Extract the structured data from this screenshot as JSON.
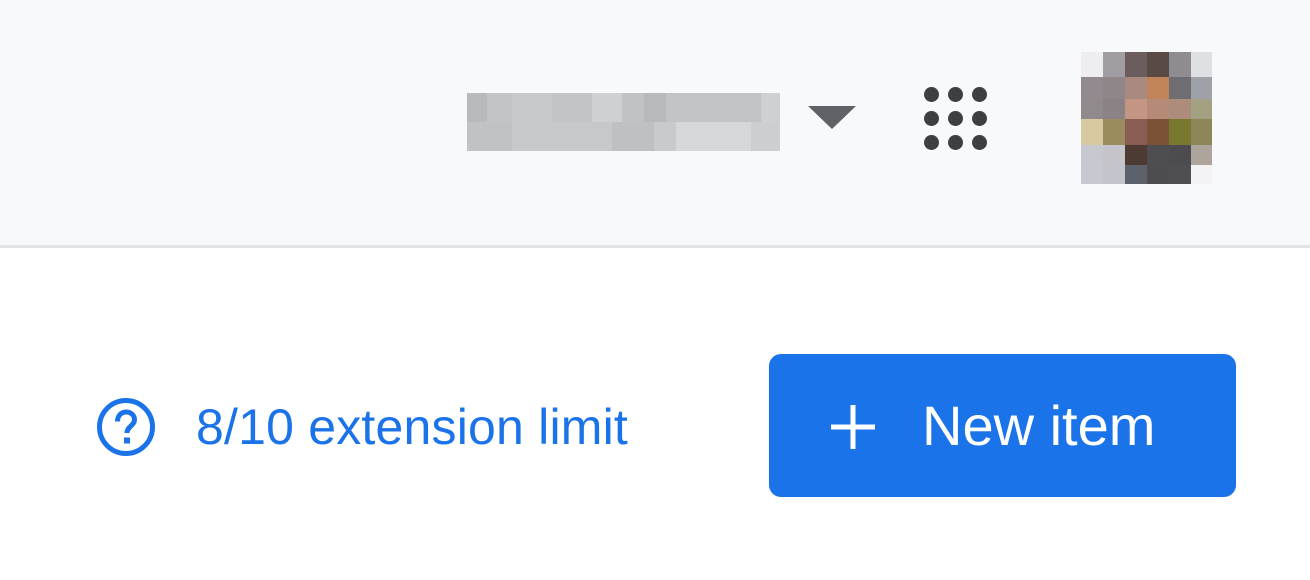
{
  "header": {
    "account_name_redacted": true,
    "dropdown_icon": "caret-down-icon",
    "apps_icon": "apps-grid-icon",
    "avatar_icon": "user-avatar"
  },
  "toolbar": {
    "limit_icon": "help-circle-icon",
    "limit_text": "8/10 extension limit",
    "new_item_icon": "plus-icon",
    "new_item_label": "New item"
  },
  "colors": {
    "accent": "#1a73e8",
    "header_bg": "#f8f9fa",
    "icon_dark": "#3c4043",
    "caret": "#5f6368"
  }
}
